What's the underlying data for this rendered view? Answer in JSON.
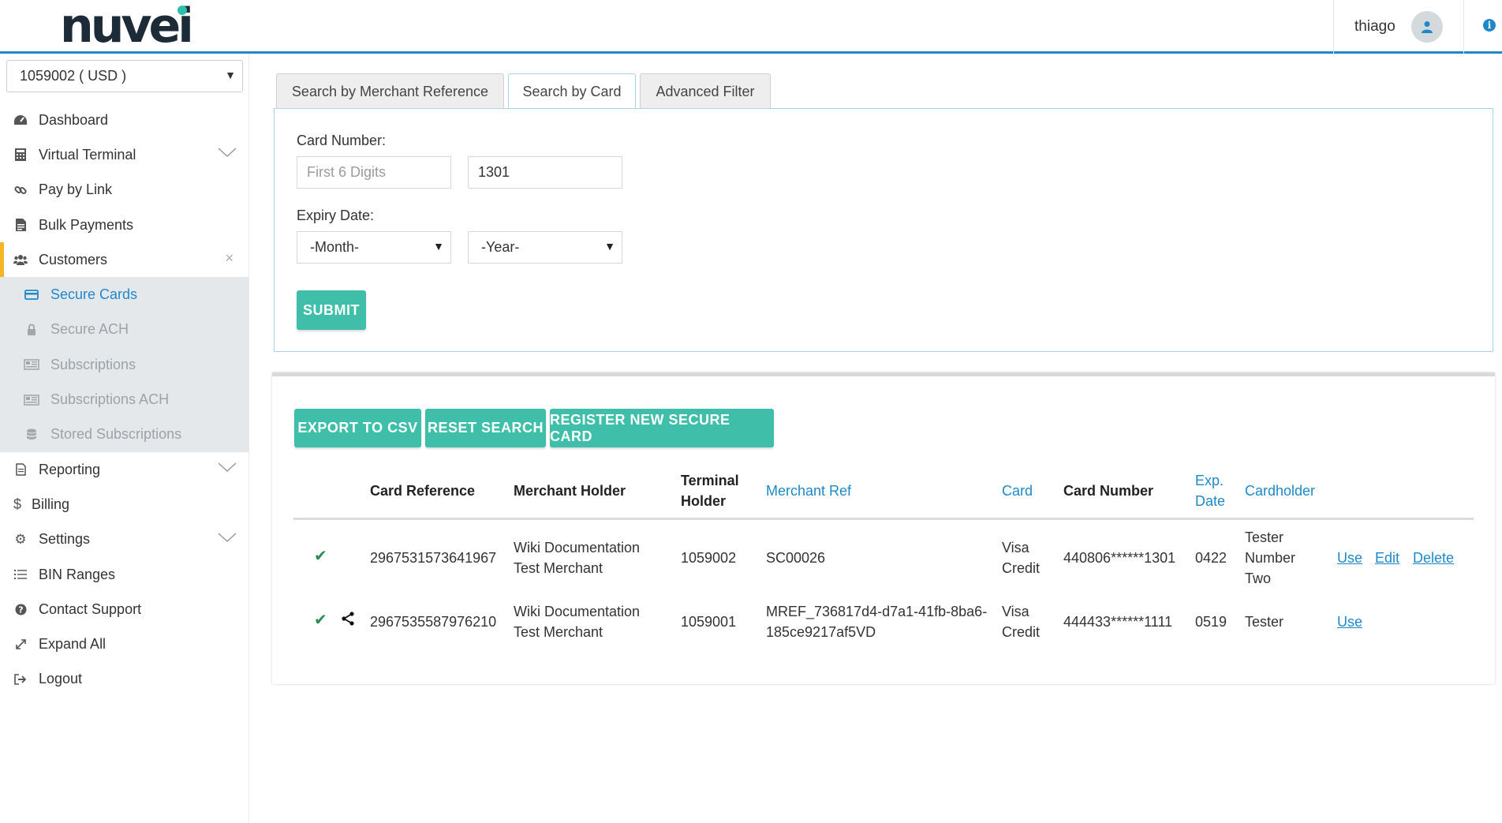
{
  "brand": {
    "logo_text": "nuvei"
  },
  "header": {
    "username": "thiago"
  },
  "sidebar": {
    "account_selector": "1059002 ( USD )",
    "items": [
      {
        "label": "Dashboard"
      },
      {
        "label": "Virtual Terminal"
      },
      {
        "label": "Pay by Link"
      },
      {
        "label": "Bulk Payments"
      },
      {
        "label": "Customers"
      },
      {
        "label": "Reporting"
      },
      {
        "label": "Billing"
      },
      {
        "label": "Settings"
      },
      {
        "label": "BIN Ranges"
      },
      {
        "label": "Contact Support"
      },
      {
        "label": "Expand All"
      },
      {
        "label": "Logout"
      }
    ],
    "customers_sub": [
      {
        "label": "Secure Cards"
      },
      {
        "label": "Secure ACH"
      },
      {
        "label": "Subscriptions"
      },
      {
        "label": "Subscriptions ACH"
      },
      {
        "label": "Stored Subscriptions"
      }
    ]
  },
  "tabs": [
    {
      "label": "Search by Merchant Reference"
    },
    {
      "label": "Search by Card"
    },
    {
      "label": "Advanced Filter"
    }
  ],
  "search_form": {
    "card_number_label": "Card Number:",
    "first6_placeholder": "First 6 Digits",
    "last4_value": "1301",
    "expiry_label": "Expiry Date:",
    "month_value": "-Month-",
    "year_value": "-Year-",
    "submit_label": "SUBMIT"
  },
  "actions": {
    "export_label": "EXPORT TO CSV",
    "reset_label": "RESET SEARCH",
    "register_label": "REGISTER NEW SECURE CARD"
  },
  "table": {
    "headers": {
      "card_reference": "Card Reference",
      "merchant_holder": "Merchant Holder",
      "terminal_holder_1": "Terminal",
      "terminal_holder_2": "Holder",
      "merchant_ref": "Merchant Ref",
      "card": "Card",
      "card_number": "Card Number",
      "exp_date_1": "Exp.",
      "exp_date_2": "Date",
      "cardholder": "Cardholder"
    },
    "rows": [
      {
        "card_reference": "2967531573641967",
        "merchant_holder_1": "Wiki Documentation",
        "merchant_holder_2": "Test Merchant",
        "terminal": "1059002",
        "merchant_ref_1": "SC00026",
        "card_1": "Visa",
        "card_2": "Credit",
        "card_number": "440806******1301",
        "exp_date": "0422",
        "cardholder_1": "Tester",
        "cardholder_2": "Number",
        "cardholder_3": "Two",
        "use": "Use",
        "edit": "Edit",
        "delete": "Delete"
      },
      {
        "card_reference": "2967535587976210",
        "merchant_holder_1": "Wiki Documentation",
        "merchant_holder_2": "Test Merchant",
        "terminal": "1059001",
        "merchant_ref_1": "MREF_736817d4-d7a1-41fb-8ba6-",
        "merchant_ref_2": "185ce9217af5VD",
        "card_1": "Visa",
        "card_2": "Credit",
        "card_number": "444433******1111",
        "exp_date": "0519",
        "cardholder_1": "Tester",
        "use": "Use"
      }
    ]
  },
  "colors": {
    "accent": "#1f88c8",
    "button": "#3fbfa9",
    "active_indicator": "#f5b62a",
    "logo_dot": "#2ebfab"
  }
}
